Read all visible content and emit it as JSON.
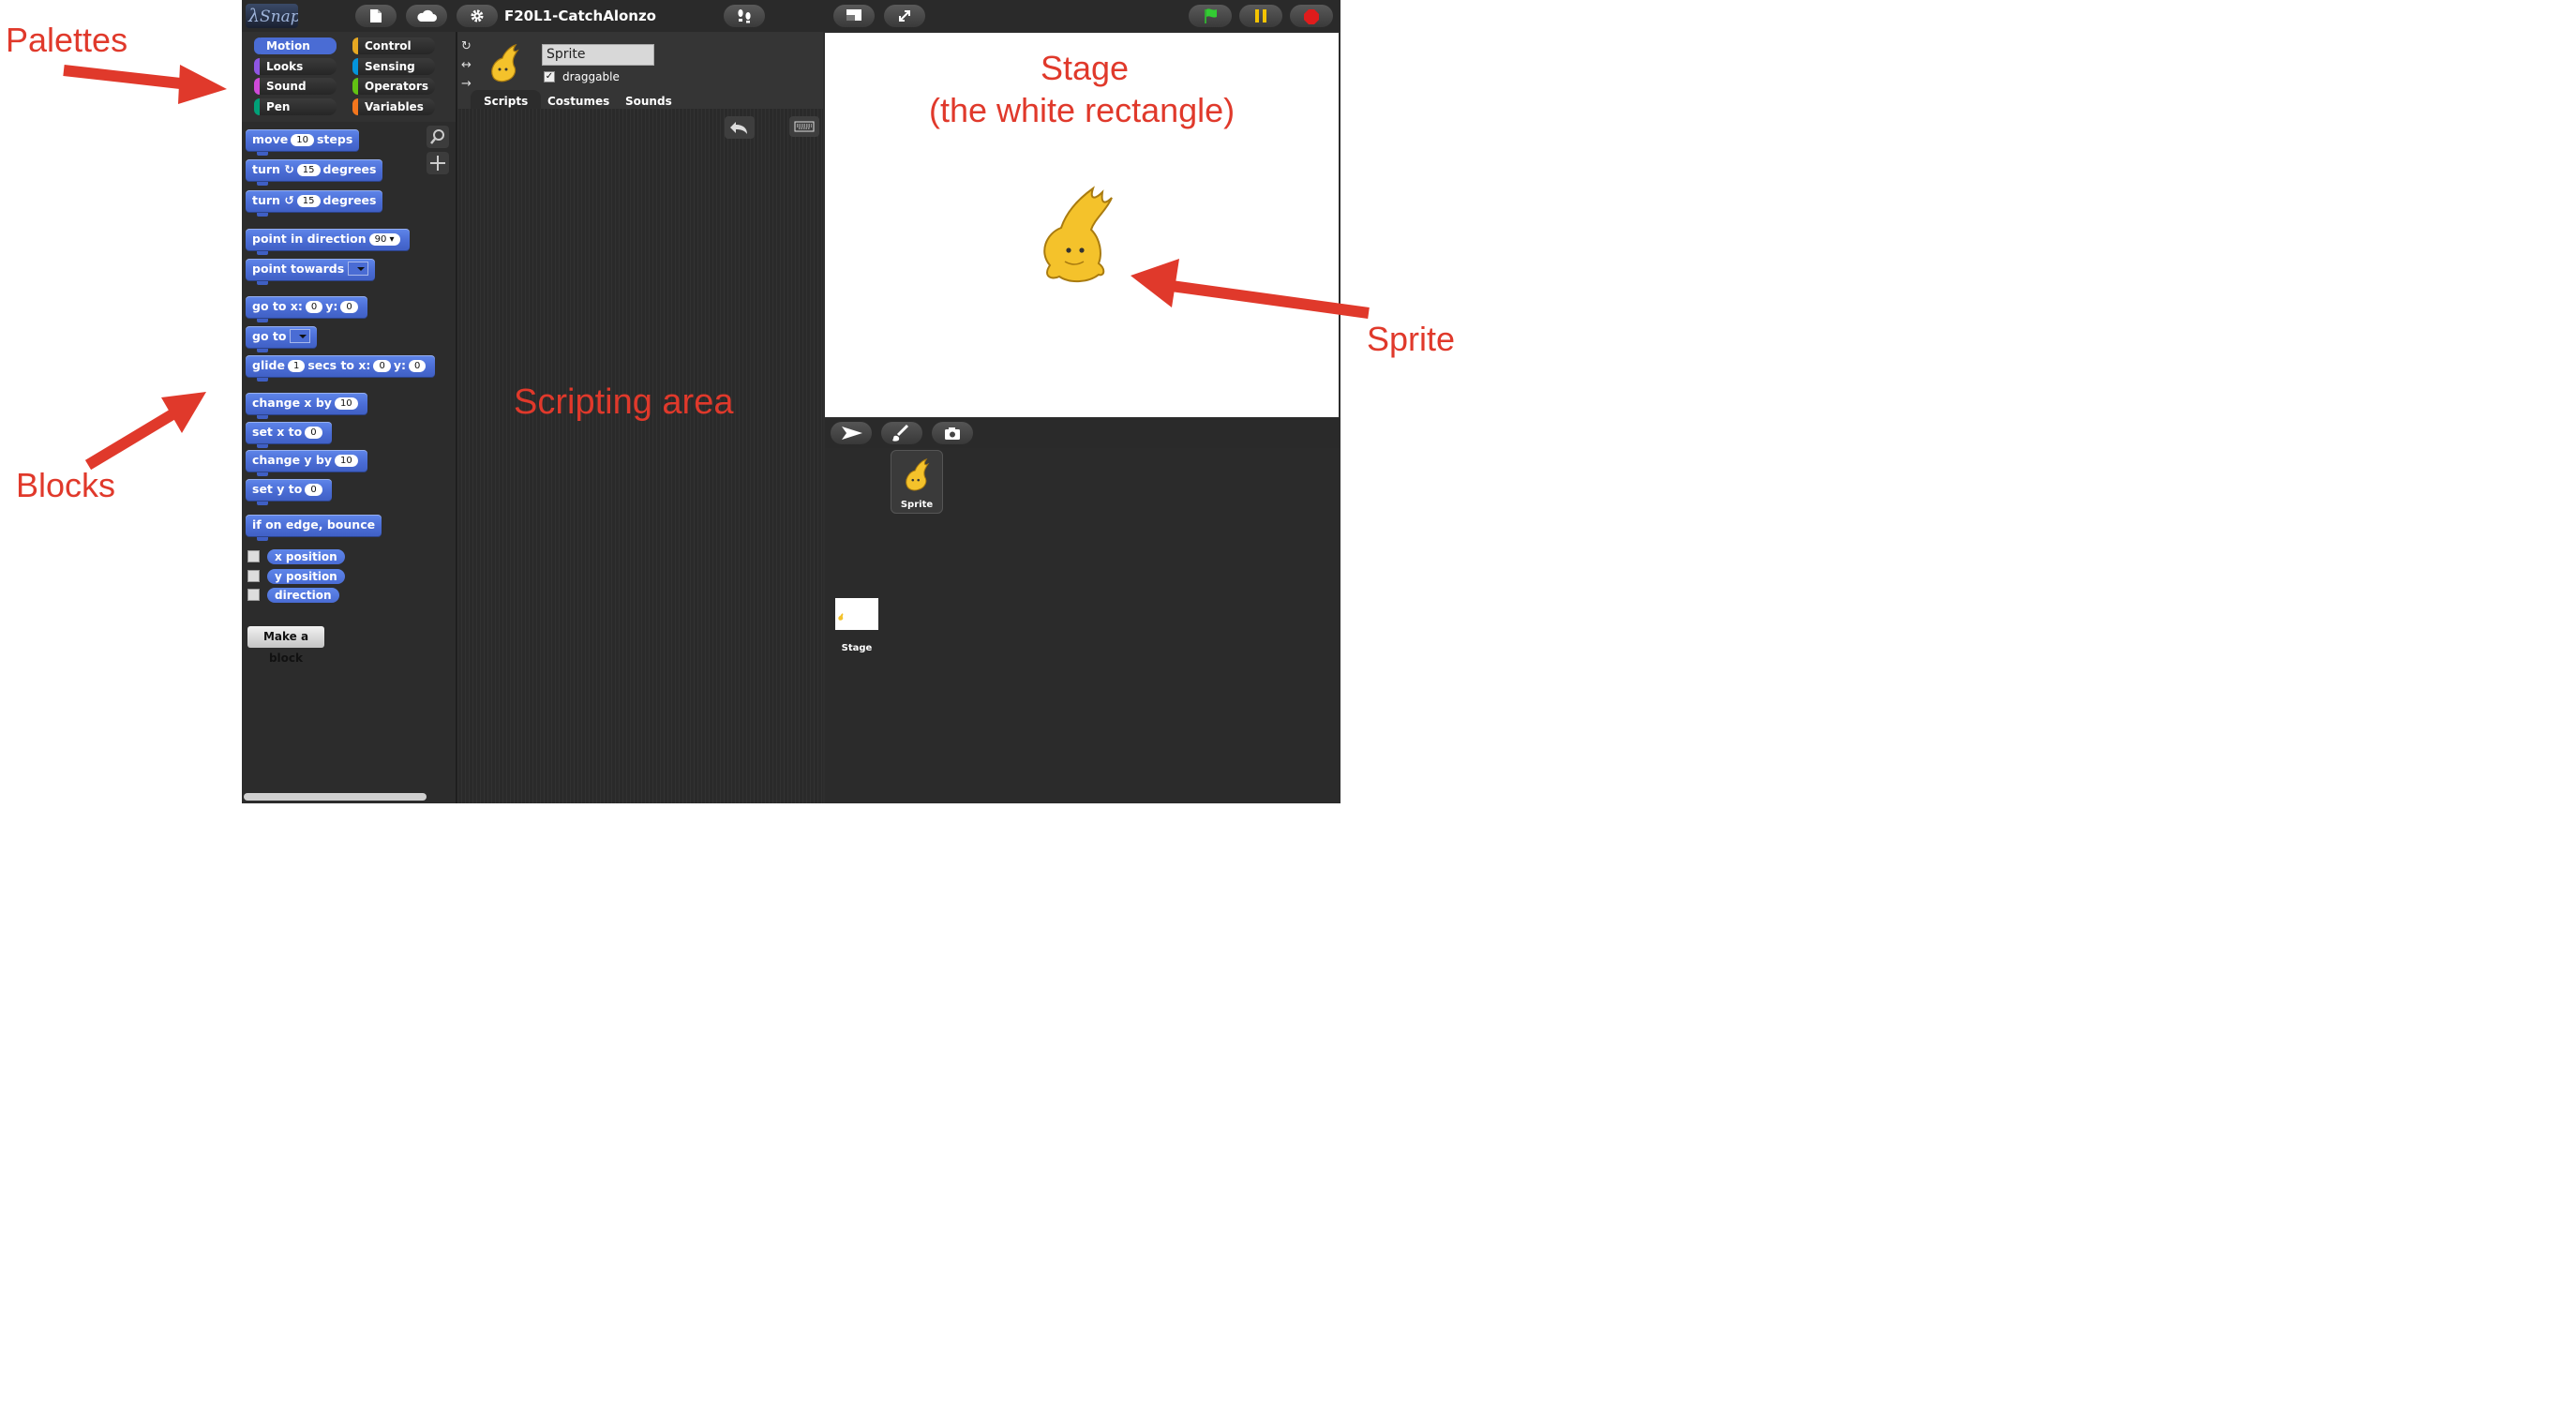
{
  "annotations": {
    "palettes": "Palettes",
    "blocks": "Blocks",
    "stage_line1": "Stage",
    "stage_line2": "(the white rectangle)",
    "sprite": "Sprite",
    "scripting_area": "Scripting area",
    "color": "#e0392b"
  },
  "topbar": {
    "logo": "Snap!",
    "project_name": "F20L1-CatchAlonzo",
    "icons": [
      "file-icon",
      "cloud-icon",
      "gear-icon",
      "footprints-icon",
      "normal-stage-icon",
      "fullscreen-icon",
      "green-flag-icon",
      "pause-icon",
      "stop-icon"
    ]
  },
  "categories": [
    {
      "label": "Motion",
      "color": "#4a6cd4",
      "active": true
    },
    {
      "label": "Control",
      "color": "#e6a822"
    },
    {
      "label": "Looks",
      "color": "#8f56e3"
    },
    {
      "label": "Sensing",
      "color": "#0494dc"
    },
    {
      "label": "Sound",
      "color": "#cf4ad9"
    },
    {
      "label": "Operators",
      "color": "#62c213"
    },
    {
      "label": "Pen",
      "color": "#00a178"
    },
    {
      "label": "Variables",
      "color": "#f3761d"
    }
  ],
  "blocks": {
    "move": {
      "pre": "move",
      "v": "10",
      "post": "steps"
    },
    "turn_cw": {
      "pre": "turn",
      "v": "15",
      "post": "degrees"
    },
    "turn_ccw": {
      "pre": "turn",
      "v": "15",
      "post": "degrees"
    },
    "point_dir": {
      "pre": "point in direction",
      "v": "90"
    },
    "point_towards": {
      "pre": "point towards"
    },
    "goto_xy": {
      "pre": "go to x:",
      "x": "0",
      "mid": "y:",
      "y": "0"
    },
    "goto": {
      "pre": "go to"
    },
    "glide": {
      "pre": "glide",
      "v": "1",
      "mid": "secs to x:",
      "x": "0",
      "mid2": "y:",
      "y": "0"
    },
    "change_x": {
      "pre": "change x by",
      "v": "10"
    },
    "set_x": {
      "pre": "set x to",
      "v": "0"
    },
    "change_y": {
      "pre": "change y by",
      "v": "10"
    },
    "set_y": {
      "pre": "set y to",
      "v": "0"
    },
    "bounce": {
      "pre": "if on edge, bounce"
    },
    "reporters": [
      "x position",
      "y position",
      "direction"
    ],
    "make_block": "Make a block"
  },
  "sprite_bar": {
    "name": "Sprite",
    "draggable_label": "draggable",
    "draggable_checked": "✓",
    "tabs": [
      "Scripts",
      "Costumes",
      "Sounds"
    ],
    "active_tab": "Scripts"
  },
  "corral": {
    "sprite_label": "Sprite",
    "stage_label": "Stage"
  }
}
